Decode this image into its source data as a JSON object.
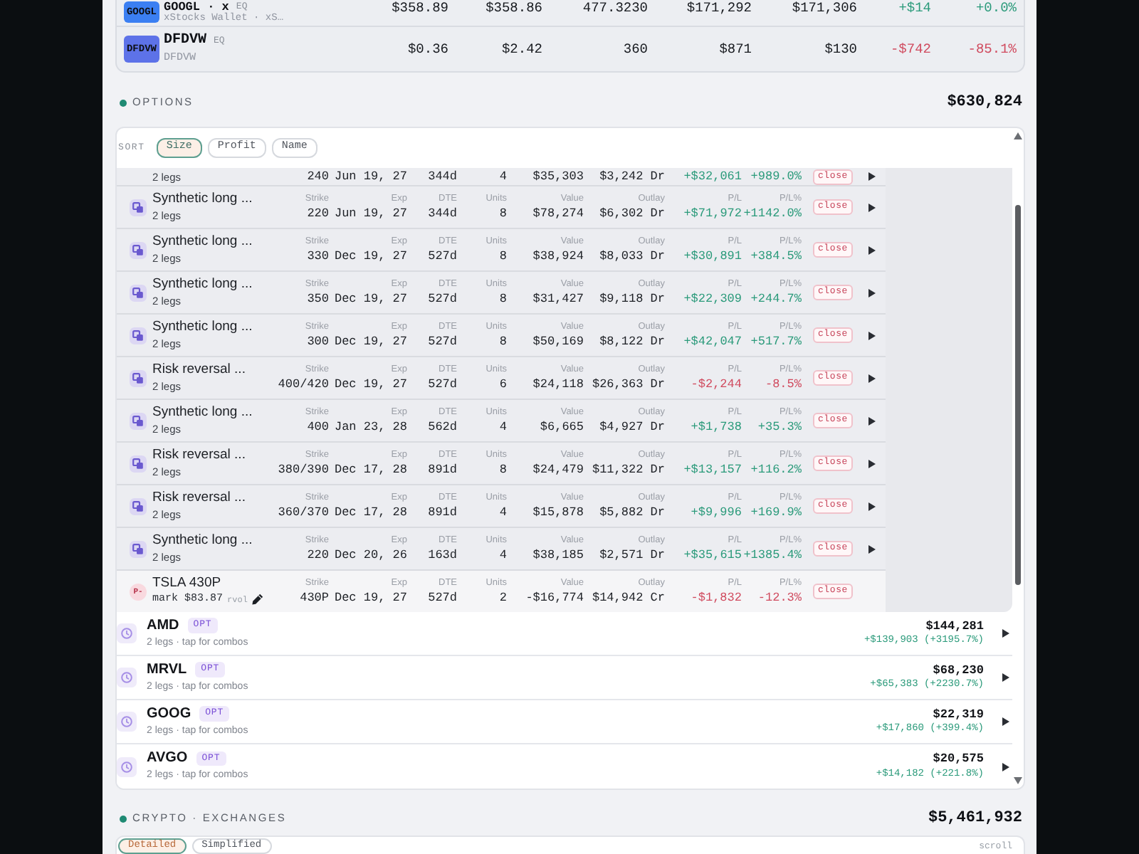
{
  "holdings": {
    "rows": [
      {
        "logo": "GOOGL",
        "color": "#3b7ff2",
        "name": "GOOGL · x",
        "type": "EQ",
        "subtitle": "xStocks Wallet · xS…",
        "cells": [
          "$358.89",
          "$358.86",
          "477.3230",
          "$171,292",
          "$171,306",
          "+$14",
          "+0.0%"
        ],
        "gain": true
      },
      {
        "logo": "DFDVW",
        "color": "#5d72e8",
        "name": "DFDVW",
        "type": "EQ",
        "subtitle": "DFDVW",
        "cells": [
          "$0.36",
          "$2.42",
          "360",
          "$871",
          "$130",
          "-$742",
          "-85.1%"
        ],
        "gain": false
      }
    ]
  },
  "options": {
    "title": "OPTIONS",
    "total": "$630,824",
    "sort": {
      "label": "SORT",
      "options": [
        {
          "label": "Size",
          "selected": true
        },
        {
          "label": "Profit",
          "selected": false
        },
        {
          "label": "Name",
          "selected": false
        }
      ]
    },
    "combos": [
      {
        "kind": "combo",
        "subtitle": "2 legs",
        "values": [
          "240",
          "Jun 19, 27",
          "344d",
          "4",
          "$35,303",
          "$3,242 Dr",
          "+$32,061",
          "+989.0%"
        ],
        "gain": true,
        "action": "close",
        "expandable": true
      },
      {
        "kind": "combo",
        "name": "Synthetic long ...",
        "subtitle": "2 legs",
        "labels": [
          "Strike",
          "Exp",
          "DTE",
          "Units",
          "Value",
          "Outlay",
          "P/L",
          "P/L%"
        ],
        "values": [
          "220",
          "Jun 19, 27",
          "344d",
          "8",
          "$78,274",
          "$6,302 Dr",
          "+$71,972",
          "+1142.0%"
        ],
        "gain": true,
        "action": "close",
        "expandable": true
      },
      {
        "kind": "combo",
        "name": "Synthetic long ...",
        "subtitle": "2 legs",
        "labels": [
          "Strike",
          "Exp",
          "DTE",
          "Units",
          "Value",
          "Outlay",
          "P/L",
          "P/L%"
        ],
        "values": [
          "330",
          "Dec 19, 27",
          "527d",
          "8",
          "$38,924",
          "$8,033 Dr",
          "+$30,891",
          "+384.5%"
        ],
        "gain": true,
        "action": "close",
        "expandable": true
      },
      {
        "kind": "combo",
        "name": "Synthetic long ...",
        "subtitle": "2 legs",
        "labels": [
          "Strike",
          "Exp",
          "DTE",
          "Units",
          "Value",
          "Outlay",
          "P/L",
          "P/L%"
        ],
        "values": [
          "350",
          "Dec 19, 27",
          "527d",
          "8",
          "$31,427",
          "$9,118 Dr",
          "+$22,309",
          "+244.7%"
        ],
        "gain": true,
        "action": "close",
        "expandable": true
      },
      {
        "kind": "combo",
        "name": "Synthetic long ...",
        "subtitle": "2 legs",
        "labels": [
          "Strike",
          "Exp",
          "DTE",
          "Units",
          "Value",
          "Outlay",
          "P/L",
          "P/L%"
        ],
        "values": [
          "300",
          "Dec 19, 27",
          "527d",
          "8",
          "$50,169",
          "$8,122 Dr",
          "+$42,047",
          "+517.7%"
        ],
        "gain": true,
        "action": "close",
        "expandable": true
      },
      {
        "kind": "combo",
        "name": "Risk reversal ...",
        "subtitle": "2 legs",
        "labels": [
          "Strike",
          "Exp",
          "DTE",
          "Units",
          "Value",
          "Outlay",
          "P/L",
          "P/L%"
        ],
        "values": [
          "400/420",
          "Dec 19, 27",
          "527d",
          "6",
          "$24,118",
          "$26,363 Dr",
          "-$2,244",
          "-8.5%"
        ],
        "gain": false,
        "action": "close",
        "expandable": true
      },
      {
        "kind": "combo",
        "name": "Synthetic long ...",
        "subtitle": "2 legs",
        "labels": [
          "Strike",
          "Exp",
          "DTE",
          "Units",
          "Value",
          "Outlay",
          "P/L",
          "P/L%"
        ],
        "values": [
          "400",
          "Jan 23, 28",
          "562d",
          "4",
          "$6,665",
          "$4,927 Dr",
          "+$1,738",
          "+35.3%"
        ],
        "gain": true,
        "action": "close",
        "expandable": true
      },
      {
        "kind": "combo",
        "name": "Risk reversal ...",
        "subtitle": "2 legs",
        "labels": [
          "Strike",
          "Exp",
          "DTE",
          "Units",
          "Value",
          "Outlay",
          "P/L",
          "P/L%"
        ],
        "values": [
          "380/390",
          "Dec 17, 28",
          "891d",
          "8",
          "$24,479",
          "$11,322 Dr",
          "+$13,157",
          "+116.2%"
        ],
        "gain": true,
        "action": "close",
        "expandable": true
      },
      {
        "kind": "combo",
        "name": "Risk reversal ...",
        "subtitle": "2 legs",
        "labels": [
          "Strike",
          "Exp",
          "DTE",
          "Units",
          "Value",
          "Outlay",
          "P/L",
          "P/L%"
        ],
        "values": [
          "360/370",
          "Dec 17, 28",
          "891d",
          "4",
          "$15,878",
          "$5,882 Dr",
          "+$9,996",
          "+169.9%"
        ],
        "gain": true,
        "action": "close",
        "expandable": true
      },
      {
        "kind": "combo",
        "name": "Synthetic long ...",
        "subtitle": "2 legs",
        "labels": [
          "Strike",
          "Exp",
          "DTE",
          "Units",
          "Value",
          "Outlay",
          "P/L",
          "P/L%"
        ],
        "values": [
          "220",
          "Dec 20, 26",
          "163d",
          "4",
          "$38,185",
          "$2,571 Dr",
          "+$35,615",
          "+1385.4%"
        ],
        "gain": true,
        "action": "close",
        "expandable": true
      },
      {
        "kind": "leg",
        "badge": "P-",
        "name": "TSLA 430P",
        "subtitle": "mark $83.87",
        "note": "rvol",
        "labels": [
          "Strike",
          "Exp",
          "DTE",
          "Units",
          "Value",
          "Outlay",
          "P/L",
          "P/L%"
        ],
        "values": [
          "430P",
          "Dec 19, 27",
          "527d",
          "2",
          "-$16,774",
          "$14,942 Cr",
          "-$1,832",
          "-12.3%"
        ],
        "gain": false,
        "action": "close",
        "expandable": false
      }
    ],
    "underlyings": [
      {
        "symbol": "AMD",
        "tag": "OPT",
        "subtitle": "2 legs · tap for combos",
        "value": "$144,281",
        "change": "+$139,903 (+3195.7%)",
        "gain": true
      },
      {
        "symbol": "MRVL",
        "tag": "OPT",
        "subtitle": "2 legs · tap for combos",
        "value": "$68,230",
        "change": "+$65,383 (+2230.7%)",
        "gain": true
      },
      {
        "symbol": "GOOG",
        "tag": "OPT",
        "subtitle": "2 legs · tap for combos",
        "value": "$22,319",
        "change": "+$17,860 (+399.4%)",
        "gain": true
      },
      {
        "symbol": "AVGO",
        "tag": "OPT",
        "subtitle": "2 legs · tap for combos",
        "value": "$20,575",
        "change": "+$14,182 (+221.8%)",
        "gain": true
      }
    ]
  },
  "crypto": {
    "title": "CRYPTO · EXCHANGES",
    "total": "$5,461,932",
    "views": [
      {
        "label": "Detailed",
        "selected": true
      },
      {
        "label": "Simplified",
        "selected": false
      }
    ],
    "hint": "scroll"
  }
}
